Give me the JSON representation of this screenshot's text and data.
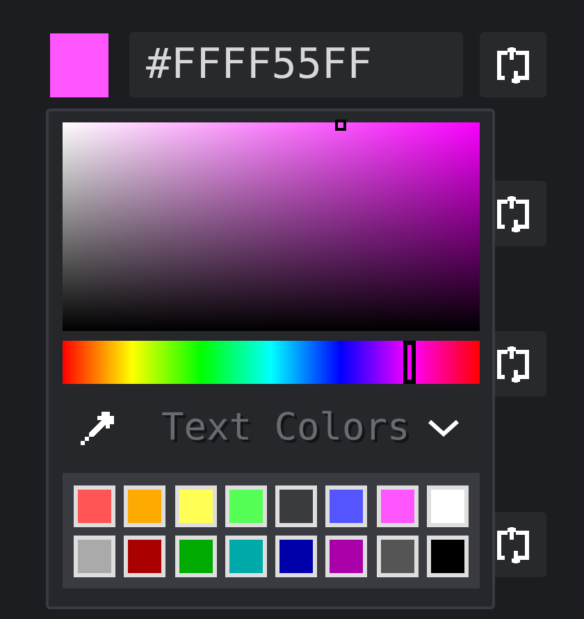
{
  "current_color": {
    "color": "#ff55ff",
    "hex": "#FFFF55FF"
  },
  "picker": {
    "hue": {
      "level": 0.83
    },
    "palette_name": "Text Colors",
    "palette": [
      {
        "color": "#ff5555"
      },
      {
        "color": "#ffaa00"
      },
      {
        "color": "#ffff55"
      },
      {
        "color": "#55ff55"
      },
      {
        "color": "#3a3b3f"
      },
      {
        "color": "#5555ff"
      },
      {
        "color": "#ff55ff"
      },
      {
        "color": "#ffffff"
      },
      {
        "color": "#aaaaaa"
      },
      {
        "color": "#aa0000"
      },
      {
        "color": "#00aa00"
      },
      {
        "color": "#00aaaa"
      },
      {
        "color": "#0000aa"
      },
      {
        "color": "#aa00aa"
      },
      {
        "color": "#555555"
      },
      {
        "color": "#000000"
      }
    ]
  }
}
